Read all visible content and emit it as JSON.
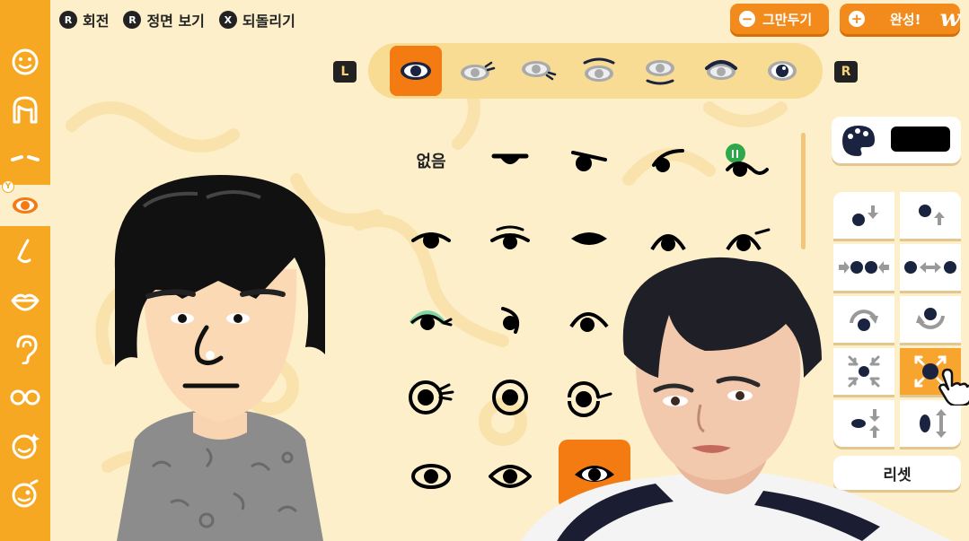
{
  "hints": {
    "rotate": {
      "glyph": "R",
      "label": "회전"
    },
    "front": {
      "glyph": "R",
      "label": "정면 보기"
    },
    "undo": {
      "glyph": "X",
      "label": "되돌리기"
    }
  },
  "top_buttons": {
    "quit": {
      "glyph": "−",
      "label": "그만두기"
    },
    "done": {
      "glyph": "+",
      "label": "완성!"
    }
  },
  "watermark": "w",
  "tab_bar": {
    "left_shoulder": "L",
    "right_shoulder": "R",
    "tabs": [
      "eye-shape-tab",
      "eyelash-tab",
      "eye-lower-lash-tab",
      "eye-brow-line-tab",
      "eye-bags-tab",
      "eye-lid-tab",
      "eye-pupil-tab"
    ],
    "active_index": 0
  },
  "sidebar": {
    "badge": "Y",
    "items": [
      "face",
      "hair",
      "eyebrows",
      "eyes",
      "nose",
      "mouth",
      "ears",
      "glasses",
      "makeup",
      "extras"
    ],
    "active": "eyes"
  },
  "eye_grid": {
    "none_label": "없음",
    "rows": 5,
    "cols": 5,
    "selected_row": 4,
    "selected_col": 2
  },
  "color_panel": {
    "swatch_color": "#000000"
  },
  "adjust_buttons": [
    "move-down",
    "move-up",
    "spacing-narrow",
    "spacing-wide",
    "rotate-clockwise",
    "rotate-counterclockwise",
    "scale-down",
    "scale-up",
    "squash-vertical",
    "stretch-vertical"
  ],
  "selected_adjust": "scale-up",
  "reset_label": "리셋",
  "colors": {
    "accent": "#F7A823",
    "orange": "#F47B12",
    "bg": "#FDEFC9"
  }
}
